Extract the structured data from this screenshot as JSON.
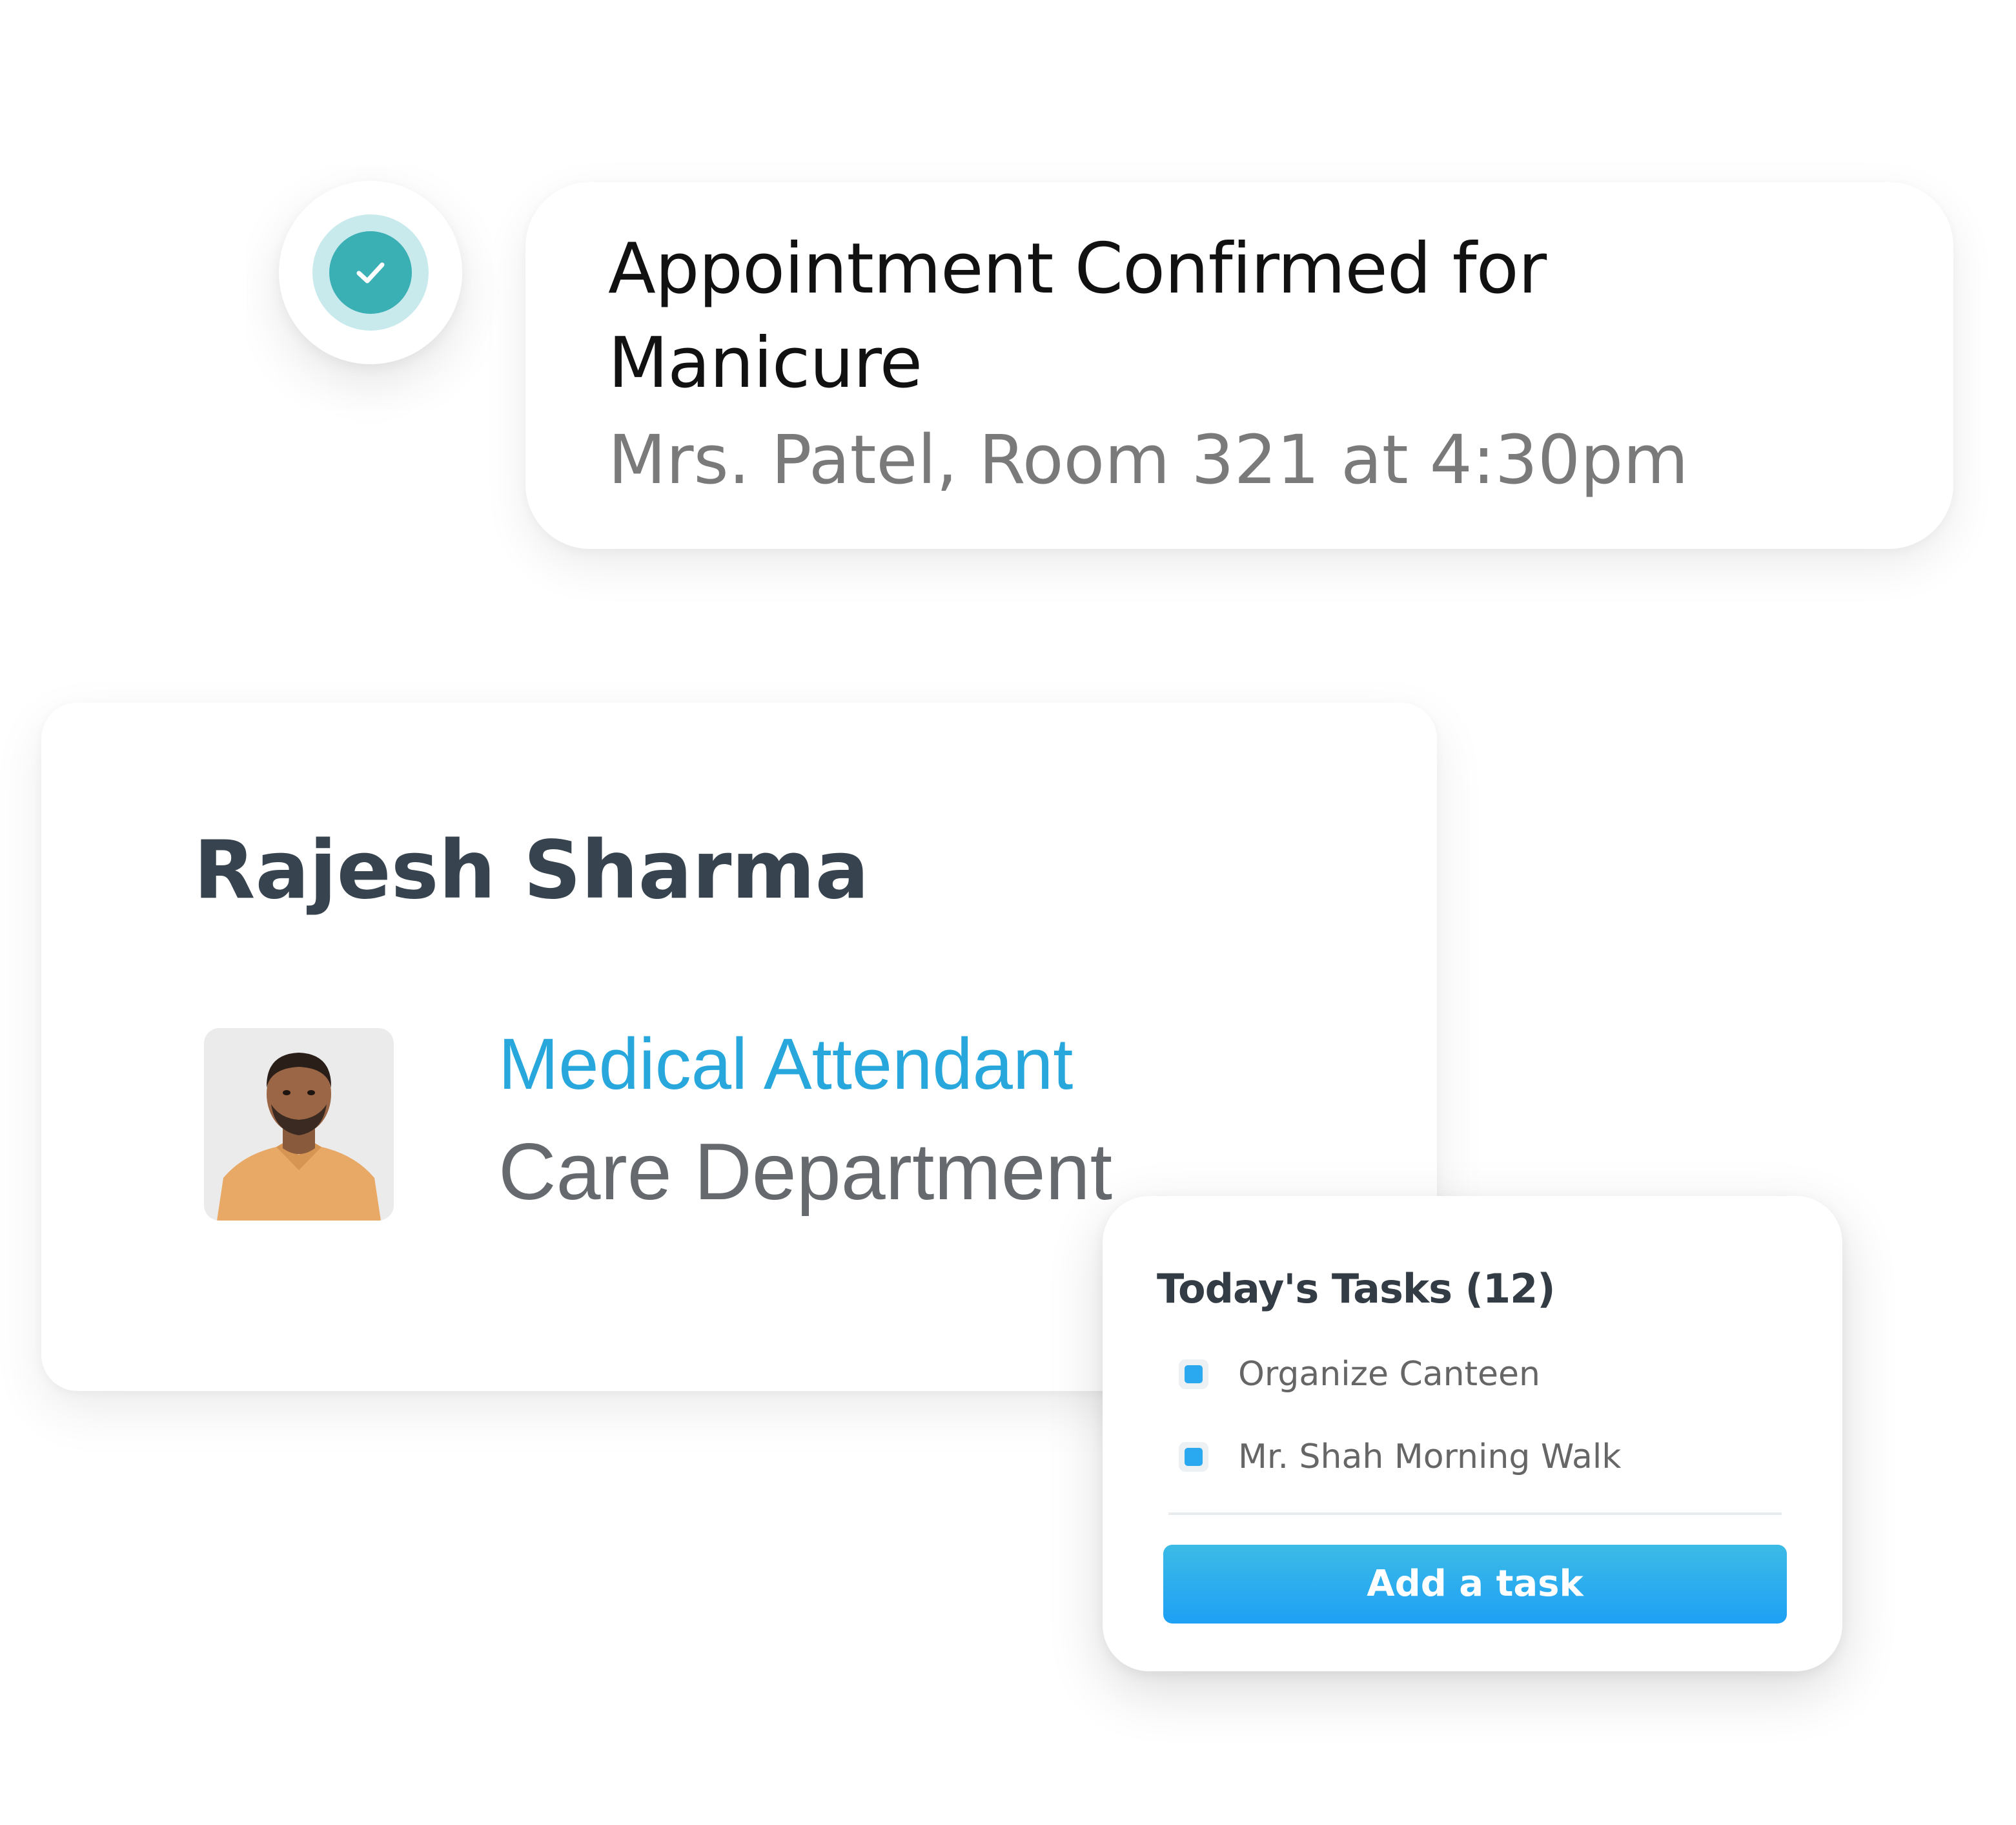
{
  "notification": {
    "icon": "check-icon",
    "title": "Appointment Confirmed for Manicure",
    "subtitle": "Mrs. Patel, Room 321 at 4:30pm"
  },
  "profile": {
    "name": "Rajesh Sharma",
    "role": "Medical Attendant",
    "department": "Care Department",
    "avatar": "profile-photo"
  },
  "tasks": {
    "title": "Today's Tasks (12)",
    "items": [
      {
        "label": "Organize Canteen"
      },
      {
        "label": "Mr. Shah Morning Walk"
      }
    ],
    "add_button_label": "Add a task"
  },
  "colors": {
    "check_ring": "#c9eaed",
    "check_fill": "#3aafb4",
    "role_text": "#27a7dc",
    "task_checkbox": "#2aa9f0",
    "button_gradient_top": "#3cbbe6",
    "button_gradient_bottom": "#1ea0f5"
  }
}
